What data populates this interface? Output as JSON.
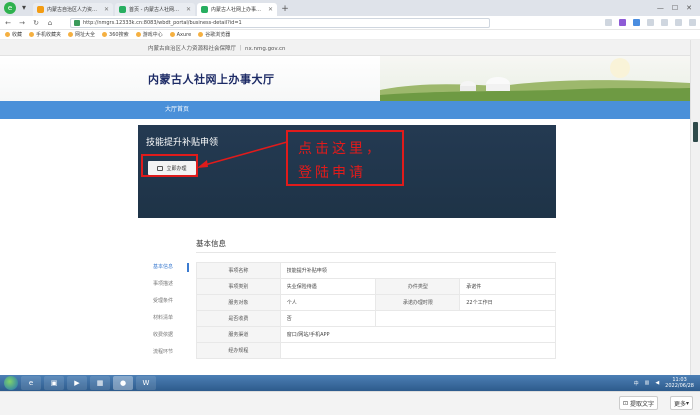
{
  "browser": {
    "tabs": [
      {
        "title": "内蒙古自治区人力资源和社会…",
        "active": false
      },
      {
        "title": "首页 - 内蒙古人社网上办事大厅",
        "active": false
      },
      {
        "title": "内蒙古人社网上办事大厅 - 内蒙古人社…",
        "active": true
      }
    ],
    "new_tab": "+",
    "address": "http://nmgrs.12333k.cn:8083/wbdt_portal/business-detail?id=1",
    "bookmarks": [
      "收藏",
      "手机收藏夹",
      "网址大全",
      "360搜索",
      "游戏中心",
      "Axure",
      "谷歌浏览器"
    ],
    "window_controls": [
      "—",
      "☐",
      "✕"
    ]
  },
  "site": {
    "topbar_text": "内蒙古自治区人力资源和社会保障厅 ｜ nx.nmg.gov.cn",
    "title": "内蒙古人社网上办事大厅",
    "nav_item": "大厅首页"
  },
  "hero": {
    "title": "技能提升补贴申领",
    "apply_button": "立即办理"
  },
  "annotation": {
    "line1": "点击这里，",
    "line2": "登陆申请"
  },
  "section": {
    "heading": "基本信息"
  },
  "sidenav": [
    "基本信息",
    "事项描述",
    "受理条件",
    "材料清单",
    "收费依据",
    "流程环节"
  ],
  "info_rows": [
    {
      "k1": "事项名称",
      "v1": "技能提升补贴申领",
      "k2": "",
      "v2": ""
    },
    {
      "k1": "事项类别",
      "v1": "失业保险待遇",
      "k2": "办件类型",
      "v2": "承诺件"
    },
    {
      "k1": "服务对象",
      "v1": "个人",
      "k2": "承诺办理时限",
      "v2": "22个工作日"
    },
    {
      "k1": "是否收费",
      "v1": "否",
      "k2": "",
      "v2": ""
    },
    {
      "k1": "服务渠道",
      "v1": "窗口/网站/手机APP",
      "k2": "",
      "v2": ""
    },
    {
      "k1": "经办规程",
      "v1": "",
      "k2": "",
      "v2": ""
    }
  ],
  "taskbar": {
    "ime": "中",
    "clock_time": "11:03",
    "clock_date": "2022/06/28"
  },
  "footer": {
    "ocr_label": "提取文字",
    "more_label": "更多"
  }
}
